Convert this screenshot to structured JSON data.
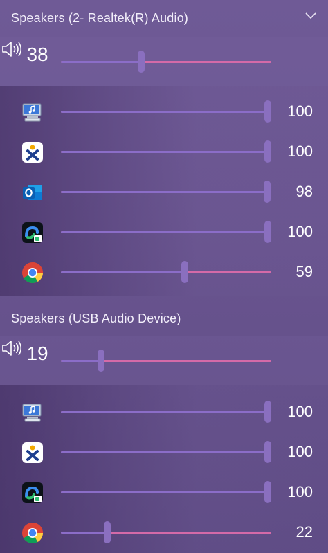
{
  "devices": [
    {
      "title": "Speakers (2- Realtek(R) Audio)",
      "master": {
        "icon": "speaker-icon",
        "volume": 38,
        "label": "38"
      },
      "apps": [
        {
          "icon": "system-sounds-icon",
          "volume": 100,
          "label": "100"
        },
        {
          "icon": "xing-icon",
          "volume": 100,
          "label": "100"
        },
        {
          "icon": "outlook-icon",
          "volume": 98,
          "label": "98"
        },
        {
          "icon": "meet-app-icon",
          "volume": 100,
          "label": "100"
        },
        {
          "icon": "chrome-icon",
          "volume": 59,
          "label": "59"
        }
      ]
    },
    {
      "title": "Speakers (USB Audio Device)",
      "master": {
        "icon": "speaker-icon",
        "volume": 19,
        "label": "19"
      },
      "apps": [
        {
          "icon": "system-sounds-icon",
          "volume": 100,
          "label": "100"
        },
        {
          "icon": "xing-icon",
          "volume": 100,
          "label": "100"
        },
        {
          "icon": "meet-app-icon",
          "volume": 100,
          "label": "100"
        },
        {
          "icon": "chrome-icon",
          "volume": 22,
          "label": "22"
        }
      ]
    }
  ],
  "colors": {
    "track_fill": "#8b6dc8",
    "track_rest": "#d46aa8",
    "thumb": "#8a6fbf"
  }
}
